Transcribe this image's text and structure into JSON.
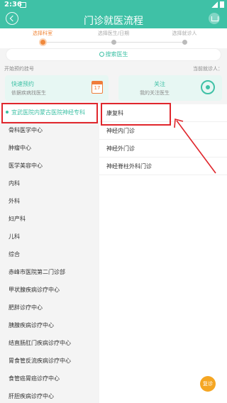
{
  "status_bar": {
    "time": "2:36"
  },
  "header": {
    "title": "门诊就医流程"
  },
  "steps": [
    {
      "label": "选择科室",
      "active": true
    },
    {
      "label": "选择医生/日期",
      "active": false
    },
    {
      "label": "选择就诊人",
      "active": false
    }
  ],
  "search": {
    "label": "搜索医生"
  },
  "sections": {
    "left_label": "开始预约挂号",
    "right_label": "当前就诊人："
  },
  "cards": {
    "quick": {
      "title": "快速预约",
      "subtitle": "依据疾病找医生",
      "calendar_day": "17"
    },
    "follow": {
      "title": "关注",
      "subtitle": "我的关注医生"
    }
  },
  "hospital_list": {
    "selected": "宜武医院内蒙古医院神经专科",
    "items": [
      "骨科医学中心",
      "肿瘤中心",
      "医学美容中心",
      "内科",
      "外科",
      "妇产科",
      "儿科",
      "综合",
      "赤峰市医院第二门诊部",
      "甲状腺疾病诊疗中心",
      "肥胖诊疗中心",
      "胰腺疾病诊疗中心",
      "结直肠肛门疾病诊疗中心",
      "胃食管反流疾病诊疗中心",
      "食管癌胃癌诊疗中心",
      "肝胆疾病诊疗中心"
    ]
  },
  "department_list": [
    "康复科",
    "神经内门诊",
    "神经外门诊",
    "神经脊柱外科门诊"
  ],
  "fab": {
    "label": "复诊"
  },
  "colors": {
    "primary": "#3fc1a6",
    "accent": "#f0893c",
    "annotation": "#e0262c"
  },
  "icons": {
    "back": "back-circle-icon",
    "home": "home-icon",
    "search": "search-icon",
    "calendar": "calendar-icon",
    "target": "target-icon"
  }
}
